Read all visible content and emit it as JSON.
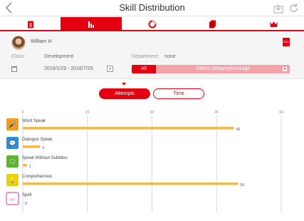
{
  "header": {
    "title": "Skill Distribution"
  },
  "tabs": [
    {
      "icon": "document-icon",
      "active": false
    },
    {
      "icon": "bar-chart-icon",
      "active": true
    },
    {
      "icon": "ring-chart-icon",
      "active": false
    },
    {
      "icon": "pages-icon",
      "active": false
    },
    {
      "icon": "crown-icon",
      "active": false
    }
  ],
  "user": {
    "name": "William H"
  },
  "filters": {
    "class_label": "Class:",
    "class_value": "Development",
    "department_label": "Department:",
    "department_value": "none",
    "date_range": "2016/1/29 - 2016/7/29",
    "category_all": "All",
    "category_placeholder": "Select category/package"
  },
  "toggle": {
    "attempts": "Attempts",
    "time": "Time",
    "selected": "Attempts"
  },
  "colors": {
    "accent": "#e3000f",
    "bar": "#f5b84e",
    "category_bg": "#f5a3aa"
  },
  "chart_data": {
    "type": "bar",
    "orientation": "horizontal",
    "xlim": [
      0,
      60
    ],
    "ticks": [
      "0",
      "15",
      "30",
      "45",
      "60"
    ],
    "grid": true,
    "categories": [
      "Word Speak",
      "Dialogue Speak",
      "Speak Without Subtitles",
      "Comprehension",
      "Spell"
    ],
    "values": [
      49,
      4,
      1,
      50,
      0
    ],
    "value_labels": [
      "49",
      "4",
      "1",
      "50",
      "0"
    ],
    "icons": [
      "microphone-icon",
      "dialogue-icon",
      "speech-bubbles-icon",
      "lightbulb-icon",
      "abc-icon"
    ],
    "icon_colors": [
      "#f29b1d",
      "#2c8fd6",
      "#5cb531",
      "#e9d20a",
      "#e576c6"
    ]
  }
}
